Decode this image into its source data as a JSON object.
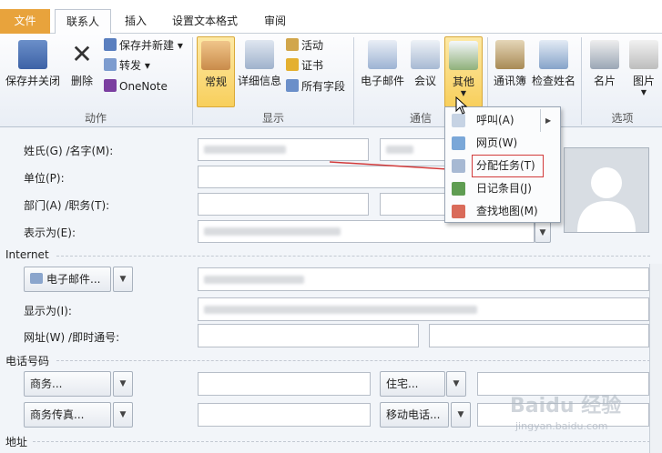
{
  "tabs": {
    "file": "文件",
    "contact": "联系人",
    "insert": "插入",
    "format_text": "设置文本格式",
    "review": "审阅"
  },
  "ribbon": {
    "save_close": "保存并关闭",
    "delete": "删除",
    "save_new": "保存并新建",
    "forward": "转发",
    "onenote": "OneNote",
    "general": "常规",
    "details": "详细信息",
    "activities": "活动",
    "certificates": "证书",
    "all_fields": "所有字段",
    "email": "电子邮件",
    "meeting": "会议",
    "more": "其他",
    "address_book": "通讯簿",
    "check_names": "检查姓名",
    "business_card": "名片",
    "picture": "图片",
    "groups": {
      "actions": "动作",
      "show": "显示",
      "communicate": "通信",
      "options": "选项"
    }
  },
  "dropdown_menu": {
    "items": [
      "呼叫(A)",
      "网页(W)",
      "分配任务(T)",
      "日记条目(J)",
      "查找地图(M)"
    ]
  },
  "form": {
    "name_label": "姓氏(G) /名字(M):",
    "company_label": "单位(P):",
    "dept_label": "部门(A) /职务(T):",
    "file_as_label": "表示为(E):",
    "internet_section": "Internet",
    "email_button": "电子邮件...",
    "display_as_label": "显示为(I):",
    "web_label": "网址(W) /即时通号:",
    "phone_section": "电话号码",
    "business_phone": "商务...",
    "home_phone": "住宅...",
    "business_fax": "商务传真...",
    "mobile_phone": "移动电话...",
    "address_section": "地址"
  },
  "watermark": "Baidu 经验",
  "watermark_sub": "jingyan.baidu.com",
  "colors": {
    "file_tab": "#e8a33c",
    "selected_button": "#f8cf5c",
    "highlight_box": "#d23a3a",
    "arrow": "#d23a3a"
  }
}
